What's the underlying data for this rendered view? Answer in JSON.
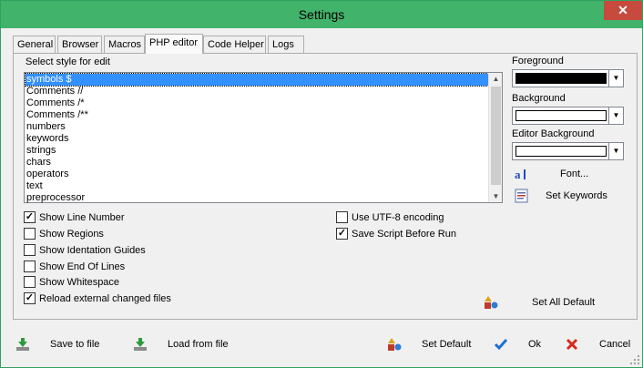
{
  "window": {
    "title": "Settings",
    "close_glyph": "✕"
  },
  "tabs": [
    {
      "label": "General"
    },
    {
      "label": "Browser"
    },
    {
      "label": "Macros"
    },
    {
      "label": "PHP editor"
    },
    {
      "label": "Code Helper"
    },
    {
      "label": "Logs"
    }
  ],
  "style_list": {
    "label": "Select style for edit",
    "items": [
      "symbols $",
      "Comments //",
      "Comments /*",
      "Comments /**",
      "numbers",
      "keywords",
      "strings",
      "chars",
      "operators",
      "text",
      "preprocessor"
    ],
    "selected_index": 0
  },
  "colors": {
    "foreground_label": "Foreground",
    "foreground_value": "#000000",
    "background_label": "Background",
    "background_value": "#ffffff",
    "editor_background_label": "Editor Background",
    "editor_background_value": "#ffffff",
    "accent": "#41b36a",
    "selection": "#3390ff"
  },
  "side_buttons": {
    "font_label": "Font...",
    "set_keywords_label": "Set Keywords",
    "set_all_default_label": "Set All Default"
  },
  "options_left": [
    {
      "label": "Show Line Number",
      "checked": true
    },
    {
      "label": "Show Regions",
      "checked": false
    },
    {
      "label": "Show Identation Guides",
      "checked": false
    },
    {
      "label": "Show End Of Lines",
      "checked": false
    },
    {
      "label": "Show Whitespace",
      "checked": false
    },
    {
      "label": "Reload external changed files",
      "checked": true
    }
  ],
  "options_right": [
    {
      "label": "Use UTF-8 encoding",
      "checked": false
    },
    {
      "label": "Save Script Before Run",
      "checked": true
    }
  ],
  "footer": {
    "save_to_file": "Save to file",
    "load_from_file": "Load from file",
    "set_default": "Set Default",
    "ok": "Ok",
    "cancel": "Cancel"
  },
  "check_glyph": "✓",
  "icons": {
    "close": "close-icon",
    "font": "font-icon",
    "keywords": "keywords-icon",
    "set_all_default": "shapes-icon",
    "save": "save-down-arrow-icon",
    "load": "load-down-arrow-icon",
    "set_default": "shapes-icon",
    "ok": "checkmark-icon",
    "cancel": "cross-icon"
  }
}
